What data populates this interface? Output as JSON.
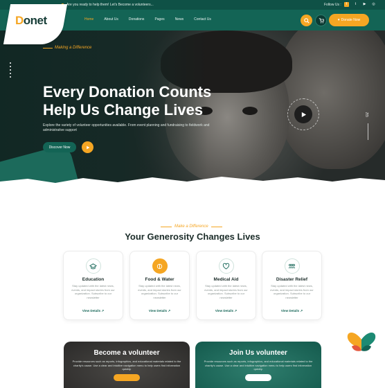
{
  "topbar": {
    "message": "Are you ready to help them! Let's Become a volunteers...",
    "follow_label": "Follow Us :",
    "social": [
      "facebook-icon",
      "twitter-icon",
      "youtube-icon",
      "instagram-icon"
    ]
  },
  "brand": {
    "logo_text": "onet",
    "logo_initial": "D"
  },
  "nav": {
    "items": [
      "Home",
      "About Us",
      "Donations",
      "Pages",
      "News",
      "Contact Us"
    ],
    "active_index": 0,
    "donate_label": "Donate Now"
  },
  "hero": {
    "tagline": "Making a Difference",
    "title_line1": "Every Donation Counts",
    "title_line2": "Help Us Change Lives",
    "description": "Explore the variety of volunteer opportunities available. From event planning and fundraising to fieldwork and administrative support",
    "discover_label": "Discover Now",
    "slide_number": "02",
    "video_ring_text": "PLAY VIDEO · PLAY VIDEO · PLAY VIDEO"
  },
  "section": {
    "tagline": "Make a Difference",
    "title": "Your Generosity Changes Lives"
  },
  "causes": [
    {
      "title": "Education",
      "desc": "Stay updated with the latest news, events, and impact stories from our organization. Subscribe to our newsletter",
      "link": "View Details"
    },
    {
      "title": "Food & Water",
      "desc": "Stay updated with the latest news, events, and impact stories from our organization. Subscribe to our newsletter",
      "link": "View Details"
    },
    {
      "title": "Medical Aid",
      "desc": "Stay updated with the latest news, events, and impact stories from our organization. Subscribe to our newsletter",
      "link": "View Details"
    },
    {
      "title": "Disaster Relief",
      "desc": "Stay updated with the latest news, events, and impact stories from our organization. Subscribe to our newsletter",
      "link": "View Details"
    }
  ],
  "volunteer": [
    {
      "title": "Become a volunteer",
      "desc": "Provide resources such as reports, infographics, and educational materials related to the charity's cause. Use a clear and intuitive navigation menu to help users find information quickly."
    },
    {
      "title": "Join Us volunteer",
      "desc": "Provide resources such as reports, infographics, and educational materials related to the charity's cause. Use a clear and intuitive navigation menu to help users find information quickly."
    }
  ],
  "colors": {
    "primary": "#136455",
    "accent": "#f5a623",
    "dark": "#0f5146"
  }
}
